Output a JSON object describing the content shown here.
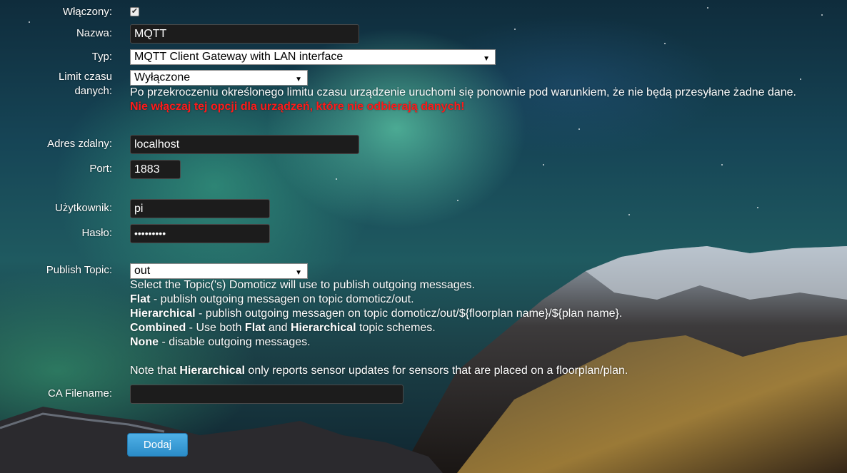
{
  "colors": {
    "input_bg": "#1c1c1c",
    "button_bg": "#3a9fd9",
    "warning_text": "#ff1a1a"
  },
  "enabled": {
    "label": "Włączony:",
    "checked": true
  },
  "name": {
    "label": "Nazwa:",
    "value": "MQTT"
  },
  "type": {
    "label": "Typ:",
    "value": "MQTT Client Gateway with LAN interface"
  },
  "timeout": {
    "label_line1": "Limit czasu",
    "label_line2": "danych:",
    "value": "Wyłączone",
    "help": "Po przekroczeniu określonego limitu czasu urządzenie uruchomi się ponownie pod warunkiem, że nie będą przesyłane żadne dane.",
    "warning": "Nie włączaj tej opcji dla urządzeń, które nie odbierają danych!"
  },
  "remote_address": {
    "label": "Adres zdalny:",
    "value": "localhost"
  },
  "port": {
    "label": "Port:",
    "value": "1883"
  },
  "username": {
    "label": "Użytkownik:",
    "value": "pi"
  },
  "password": {
    "label": "Hasło:",
    "value": "•••••••••"
  },
  "publish_topic": {
    "label": "Publish Topic:",
    "value": "out",
    "help_intro": "Select the Topic('s) Domoticz will use to publish outgoing messages.",
    "flat_term": "Flat",
    "flat_desc": " - publish outgoing messagen on topic domoticz/out.",
    "hier_term": "Hierarchical",
    "hier_desc": " - publish outgoing messagen on topic domoticz/out/${floorplan name}/${plan name}.",
    "combined_term": "Combined",
    "combined_mid1": " - Use both ",
    "combined_flat": "Flat",
    "combined_mid2": " and ",
    "combined_hier": "Hierarchical",
    "combined_end": " topic schemes.",
    "none_term": "None",
    "none_desc": " - disable outgoing messages.",
    "note_pre": "Note that ",
    "note_term": "Hierarchical",
    "note_post": " only reports sensor updates for sensors that are placed on a floorplan/plan."
  },
  "ca_filename": {
    "label": "CA Filename:",
    "value": ""
  },
  "add_button": {
    "label": "Dodaj"
  }
}
